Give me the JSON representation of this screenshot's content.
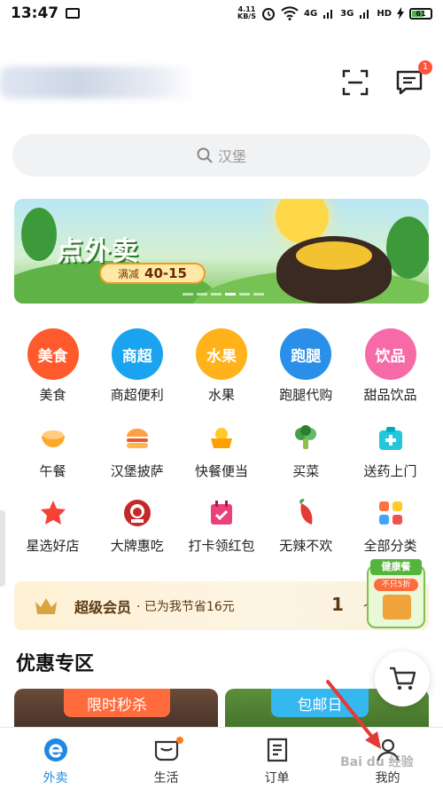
{
  "status_bar": {
    "time": "13:47",
    "net_speed_top": "4.11",
    "net_speed_bottom": "KB/S",
    "sim1": "4G",
    "sim2": "3G",
    "hd": "HD",
    "battery": "61"
  },
  "header": {
    "message_badge": "1",
    "scan_icon": "scan-icon",
    "message_icon": "message-icon"
  },
  "search": {
    "placeholder": "汉堡"
  },
  "banner": {
    "title": "点外卖",
    "tag_prefix": "满减",
    "tag_value": "40-15"
  },
  "categories_primary": [
    {
      "icon_text": "美食",
      "label": "美食",
      "color": "#ff5a2c"
    },
    {
      "icon_text": "商超",
      "label": "商超便利",
      "color": "#1aa3ee"
    },
    {
      "icon_text": "水果",
      "label": "水果",
      "color": "#ffb21a"
    },
    {
      "icon_text": "跑腿",
      "label": "跑腿代购",
      "color": "#2a8fe8"
    },
    {
      "icon_text": "饮品",
      "label": "甜品饮品",
      "color": "#f76aa8"
    }
  ],
  "categories_secondary": [
    {
      "icon": "rice-bowl-icon",
      "label": "午餐"
    },
    {
      "icon": "burger-icon",
      "label": "汉堡披萨"
    },
    {
      "icon": "fast-food-icon",
      "label": "快餐便当"
    },
    {
      "icon": "vegetable-icon",
      "label": "买菜"
    },
    {
      "icon": "medicine-box-icon",
      "label": "送药上门"
    }
  ],
  "categories_tertiary": [
    {
      "icon": "star-shop-icon",
      "label": "星选好店"
    },
    {
      "icon": "kfc-logo-icon",
      "label": "大牌惠吃"
    },
    {
      "icon": "check-in-icon",
      "label": "打卡领红包"
    },
    {
      "icon": "chili-icon",
      "label": "无辣不欢"
    },
    {
      "icon": "all-categories-icon",
      "label": "全部分类"
    }
  ],
  "member": {
    "title": "超级会员",
    "subtitle": "· 已为我节省16元",
    "count": "1",
    "count_unit": "个"
  },
  "health_badge": {
    "title": "健康餐",
    "subtitle": "不只5折"
  },
  "promo": {
    "section_title": "优惠专区",
    "card1_tag": "限时秒杀",
    "card2_tag": "包邮日"
  },
  "tabbar": {
    "tabs": [
      {
        "label": "外卖",
        "icon": "waimai-e-icon",
        "active": true
      },
      {
        "label": "生活",
        "icon": "life-bag-icon",
        "active": false
      },
      {
        "label": "订单",
        "icon": "order-list-icon",
        "active": false
      },
      {
        "label": "我的",
        "icon": "profile-icon",
        "active": false
      }
    ]
  },
  "colors": {
    "accent": "#1e88e5",
    "badge": "#ff5339",
    "member_text": "#5a3a10"
  },
  "watermark": "Bai du 经验"
}
